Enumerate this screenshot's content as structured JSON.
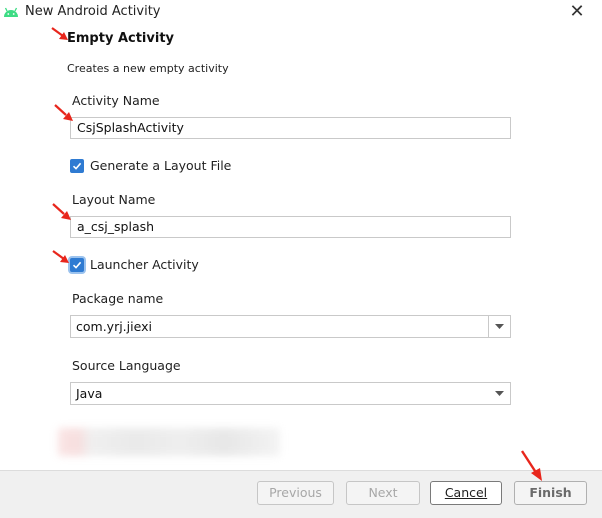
{
  "window": {
    "title": "New Android Activity",
    "app_icon": "android-icon",
    "close_icon": "close-icon",
    "close_glyph": "✕"
  },
  "header": {
    "title": "Empty Activity",
    "subtitle": "Creates a new empty activity"
  },
  "form": {
    "activity_name": {
      "label": "Activity Name",
      "value": "CsjSplashActivity"
    },
    "generate_layout": {
      "label": "Generate a Layout File",
      "checked": true
    },
    "layout_name": {
      "label": "Layout Name",
      "value": "a_csj_splash"
    },
    "launcher_activity": {
      "label": "Launcher Activity",
      "checked": true
    },
    "package_name": {
      "label": "Package name",
      "value": "com.yrj.jiexi"
    },
    "source_language": {
      "label": "Source Language",
      "value": "Java"
    }
  },
  "buttons": {
    "previous": "Previous",
    "next": "Next",
    "cancel": "Cancel",
    "finish": "Finish"
  },
  "colors": {
    "checkbox_accent": "#2f7bd2",
    "annotation_arrow": "#e8261c",
    "android_green": "#3ddc84"
  }
}
